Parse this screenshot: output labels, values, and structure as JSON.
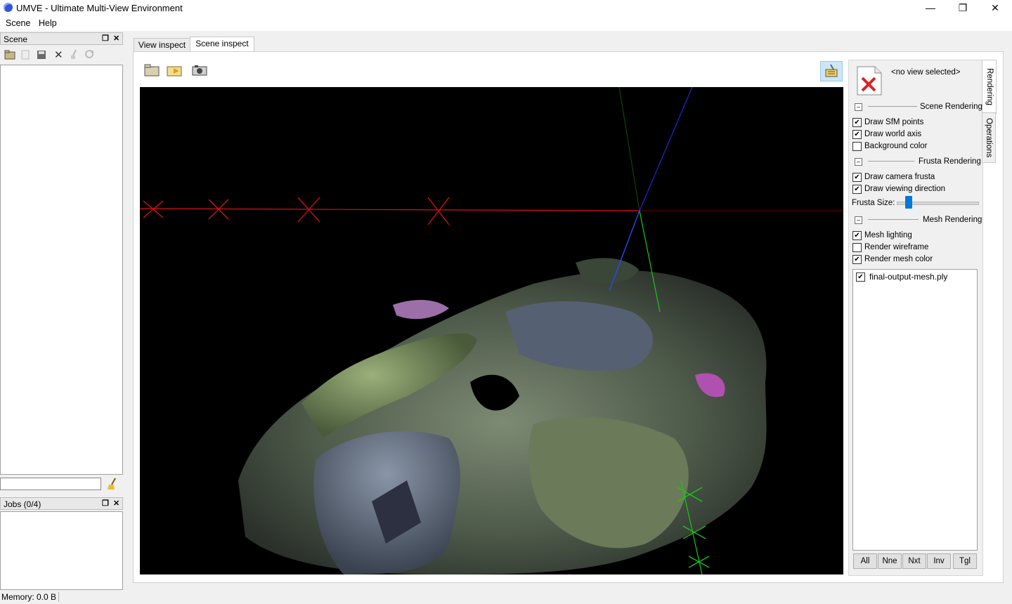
{
  "window": {
    "title": "UMVE - Ultimate Multi-View Environment"
  },
  "menu": {
    "items": [
      "Scene",
      "Help"
    ]
  },
  "scene_dock": {
    "title": "Scene",
    "filter_value": ""
  },
  "jobs_dock": {
    "title": "Jobs (0/4)"
  },
  "tabs": {
    "view_inspect": "View inspect",
    "scene_inspect": "Scene inspect"
  },
  "right_panel": {
    "no_view_label": "<no view selected>",
    "vtab_rendering": "Rendering",
    "vtab_operations": "Operations",
    "scene_rendering": {
      "title": "Scene Rendering",
      "options": [
        {
          "label": "Draw SfM points",
          "checked": true
        },
        {
          "label": "Draw world axis",
          "checked": true
        },
        {
          "label": "Background color",
          "checked": false
        }
      ]
    },
    "frusta_rendering": {
      "title": "Frusta Rendering",
      "options": [
        {
          "label": "Draw camera frusta",
          "checked": true
        },
        {
          "label": "Draw viewing direction",
          "checked": true
        }
      ],
      "size_label": "Frusta Size:",
      "size_level": 0.08
    },
    "mesh_rendering": {
      "title": "Mesh Rendering",
      "options": [
        {
          "label": "Mesh lighting",
          "checked": true
        },
        {
          "label": "Render wireframe",
          "checked": false
        },
        {
          "label": "Render mesh color",
          "checked": true
        }
      ]
    },
    "mesh_list": [
      {
        "label": "final-output-mesh.ply",
        "checked": true
      }
    ],
    "buttons": [
      "All",
      "Nne",
      "Nxt",
      "Inv",
      "Tgl"
    ]
  },
  "status": {
    "memory": "Memory: 0.0 B"
  },
  "colors": {
    "x_axis": "#e01010",
    "y_axis": "#18c818",
    "z_axis": "#1a2ad0",
    "background": "#000000"
  }
}
